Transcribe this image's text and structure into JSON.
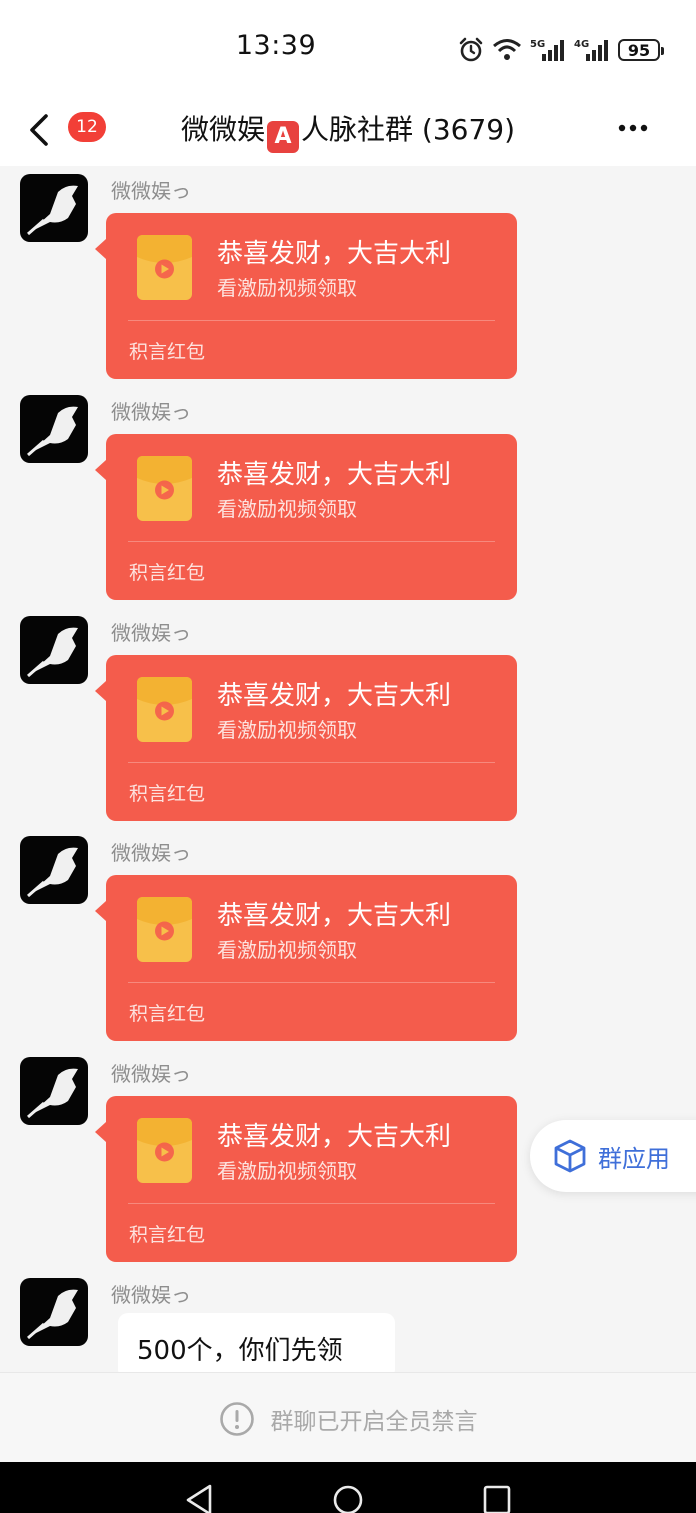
{
  "status_bar": {
    "time": "13:39",
    "battery": "95",
    "icons": [
      "alarm-icon",
      "wifi-icon",
      "signal-5g-icon",
      "signal-4g-icon",
      "battery-icon"
    ],
    "network_1": "5G",
    "network_2": "4G"
  },
  "header": {
    "unread_count": "12",
    "title_prefix": "微微娱",
    "title_badge": "A",
    "title_suffix": "人脉社群 (3679)"
  },
  "messages": [
    {
      "sender": "微微娱っ",
      "type": "red-packet",
      "title": "恭喜发财，大吉大利",
      "subtitle": "看激励视频领取",
      "label": "积言红包"
    },
    {
      "sender": "微微娱っ",
      "type": "red-packet",
      "title": "恭喜发财，大吉大利",
      "subtitle": "看激励视频领取",
      "label": "积言红包"
    },
    {
      "sender": "微微娱っ",
      "type": "red-packet",
      "title": "恭喜发财，大吉大利",
      "subtitle": "看激励视频领取",
      "label": "积言红包"
    },
    {
      "sender": "微微娱っ",
      "type": "red-packet",
      "title": "恭喜发财，大吉大利",
      "subtitle": "看激励视频领取",
      "label": "积言红包"
    },
    {
      "sender": "微微娱っ",
      "type": "red-packet",
      "title": "恭喜发财，大吉大利",
      "subtitle": "看激励视频领取",
      "label": "积言红包"
    },
    {
      "sender": "微微娱っ",
      "type": "text",
      "text": "500个，你们先领"
    }
  ],
  "group_apps": {
    "label": "群应用"
  },
  "mute_notice": {
    "text": "群聊已开启全员禁言"
  },
  "colors": {
    "packet": "#f45c4c",
    "packet_icon": "#f7c04a",
    "badge": "#f23f37",
    "accent_blue": "#3f6fd9"
  }
}
